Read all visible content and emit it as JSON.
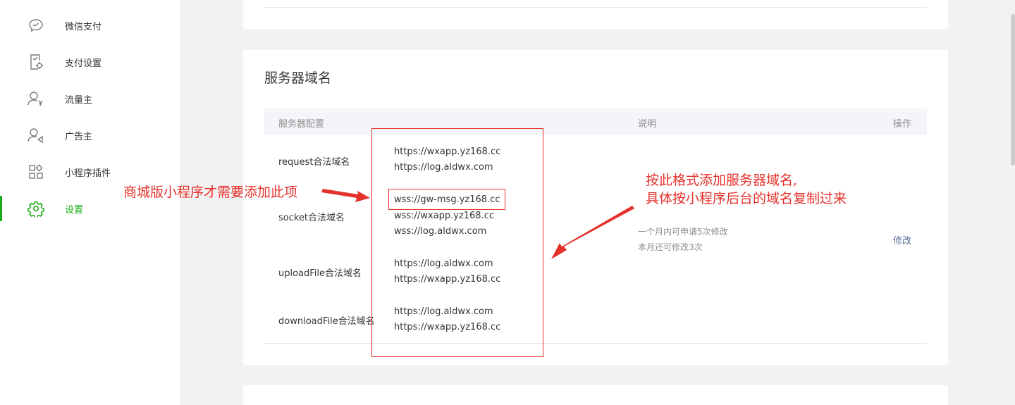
{
  "sidebar": {
    "items": [
      {
        "label": "微信支付",
        "icon": "chat-bubble-icon",
        "active": false
      },
      {
        "label": "支付设置",
        "icon": "payment-settings-icon",
        "active": false
      },
      {
        "label": "流量主",
        "icon": "traffic-owner-icon",
        "active": false
      },
      {
        "label": "广告主",
        "icon": "advertiser-icon",
        "active": false
      },
      {
        "label": "小程序插件",
        "icon": "plugin-grid-icon",
        "active": false
      },
      {
        "label": "设置",
        "icon": "gear-icon",
        "active": true
      }
    ]
  },
  "server_domain": {
    "title": "服务器域名",
    "columns": {
      "config": "服务器配置",
      "description": "说明",
      "action": "操作"
    },
    "rows": [
      {
        "label": "request合法域名",
        "domains": [
          "https://wxapp.yz168.cc",
          "https://log.aldwx.com"
        ]
      },
      {
        "label": "socket合法域名",
        "domains": [
          "wss://gw-msg.yz168.cc",
          "wss://wxapp.yz168.cc",
          "wss://log.aldwx.com"
        ]
      },
      {
        "label": "uploadFile合法域名",
        "domains": [
          "https://log.aldwx.com",
          "https://wxapp.yz168.cc"
        ]
      },
      {
        "label": "downloadFile合法域名",
        "domains": [
          "https://log.aldwx.com",
          "https://wxapp.yz168.cc"
        ]
      }
    ],
    "note_line1": "一个月内可申请5次修改",
    "note_line2": "本月还可修改3次",
    "modify_label": "修改"
  },
  "annotations": {
    "left_text": "商城版小程序才需要添加此项",
    "right_line1": "按此格式添加服务器域名,",
    "right_line2": "具体按小程序后台的域名复制过来",
    "color": "#e5312b"
  },
  "colors": {
    "accent": "#1aad19",
    "link": "#576b95"
  }
}
